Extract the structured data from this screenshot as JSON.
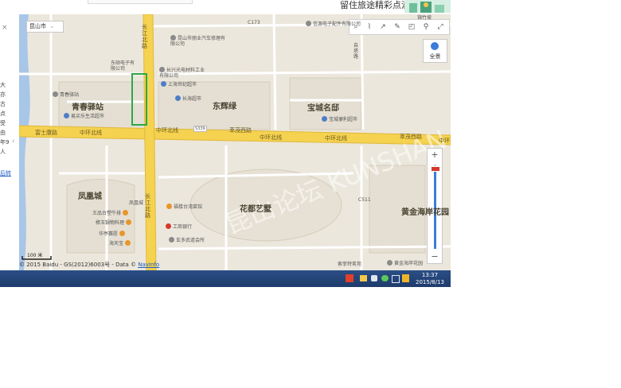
{
  "banner": {
    "text": "留住旅途精彩点滴"
  },
  "left_panel": {
    "close_glyph": "×",
    "lines": [
      "大",
      "亦",
      "古",
      "点",
      "受",
      "由",
      "年9",
      "人"
    ],
    "link_text": "后转",
    "arrow_glyph": "‹"
  },
  "map": {
    "city_selector": {
      "label": "昆山市",
      "arrow": "⌄"
    },
    "toolbar_icons": [
      "search-icon",
      "ruler-icon",
      "share-icon",
      "edit-icon",
      "measure-icon",
      "pin-icon",
      "fullscreen-icon"
    ],
    "panorama_label": "全景",
    "zoom": {
      "plus": "+",
      "minus": "−",
      "level_fraction": 0.95
    },
    "scale": "100 米",
    "copyright_prefix": "© 2015 Baidu - GS(2012)6003号 - Data © ",
    "copyright_link": "NavInfo",
    "watermark": "昆山论坛 KUNSHAN BBS",
    "districts": [
      "青春驿站",
      "东辉绿",
      "宝城名邸",
      "凤凰城",
      "花都艺墅",
      "黄金海岸花园"
    ],
    "roads": {
      "main_left": "富士康路",
      "ring1": "中环北线",
      "ring2": "中环北线",
      "ring3": "中环北线",
      "ring4": "中环北线",
      "jingmao_left": "萃茂西路",
      "jingmao_right": "萃茂西路",
      "changjiang_top": "长江北路",
      "changjiang_bottom": "长江北路",
      "c173": "C173",
      "s339": "S339",
      "c511": "C511",
      "zibo": "自塔路",
      "ring_right": "中环"
    },
    "pois": {
      "p1": "昆山市丽业汽车修理有限公司",
      "p2": "信源电子配件有限公司",
      "p3": "东硕电子有限公司",
      "p4": "长兴光电材料工业有限公司",
      "p5": "上海世纪超市",
      "p6": "青春驿站",
      "p7": "长海超市",
      "p8": "易买乐生活超市",
      "p9": "宝城便利超市",
      "p10": "凤凰城",
      "p11": "福楼台湾菜馆",
      "p12": "王品台塑牛排",
      "p13": "樟玉锅物料理",
      "p14": "华亭赛愿",
      "p15": "海天宝",
      "p16": "工商银行",
      "p17": "玄多武道会所",
      "p18": "索菲特茗苑",
      "p19": "黄金海岸花园"
    },
    "top_fragment": "锦竹坡"
  },
  "taskbar": {
    "time": "13:37",
    "date": "2015/8/13"
  },
  "colors": {
    "map_bg": "#ece7dc",
    "major_road": "#f5d24f",
    "road_edge": "#e0b83a",
    "water": "#a8c6e8",
    "selection": "#2aa84a",
    "taskbar": "#1e3c6c"
  }
}
